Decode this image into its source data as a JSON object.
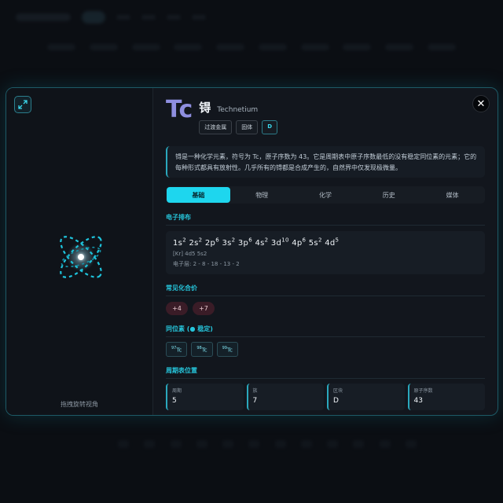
{
  "element": {
    "symbol": "Tc",
    "cn_name": "锝",
    "en_name": "Technetium",
    "tags": [
      "过渡金属",
      "固体"
    ],
    "block_tag": "D",
    "description": "锝是一种化学元素，符号为 Tc，原子序数为 43。它是周期表中原子序数最低的没有稳定同位素的元素；它的每种形式都具有放射性。几乎所有的锝都是合成产生的，自然界中仅发现极微量。"
  },
  "left_pane": {
    "rotate_hint": "拖拽旋转视角"
  },
  "tabs": [
    {
      "label": "基础",
      "active": true
    },
    {
      "label": "物理",
      "active": false
    },
    {
      "label": "化学",
      "active": false
    },
    {
      "label": "历史",
      "active": false
    },
    {
      "label": "媒体",
      "active": false
    }
  ],
  "electron_config": {
    "title": "电子排布",
    "orbitals": [
      {
        "orbital": "1s",
        "count": "2"
      },
      {
        "orbital": "2s",
        "count": "2"
      },
      {
        "orbital": "2p",
        "count": "6"
      },
      {
        "orbital": "3s",
        "count": "2"
      },
      {
        "orbital": "3p",
        "count": "6"
      },
      {
        "orbital": "4s",
        "count": "2"
      },
      {
        "orbital": "3d",
        "count": "10"
      },
      {
        "orbital": "4p",
        "count": "6"
      },
      {
        "orbital": "5s",
        "count": "2"
      },
      {
        "orbital": "4d",
        "count": "5"
      }
    ],
    "short": "[Kr] 4d5 5s2",
    "shells": "电子层: 2 - 8 - 18 - 13 - 2"
  },
  "oxidation": {
    "title": "常见化合价",
    "states": [
      "+4",
      "+7"
    ]
  },
  "isotopes": {
    "title": "同位素",
    "legend_mark": "●",
    "legend_text": "稳定",
    "items": [
      {
        "mass": "97",
        "symbol": "Tc"
      },
      {
        "mass": "98",
        "symbol": "Tc"
      },
      {
        "mass": "99",
        "symbol": "Tc"
      }
    ]
  },
  "position": {
    "title": "周期表位置",
    "cards": [
      {
        "label": "周期",
        "value": "5"
      },
      {
        "label": "族",
        "value": "7"
      },
      {
        "label": "区块",
        "value": "D"
      },
      {
        "label": "原子序数",
        "value": "43"
      }
    ]
  },
  "colors": {
    "accent": "#1ed6ee",
    "symbol": "#8f8fe0",
    "oxidation_bg": "#3a1c27"
  }
}
